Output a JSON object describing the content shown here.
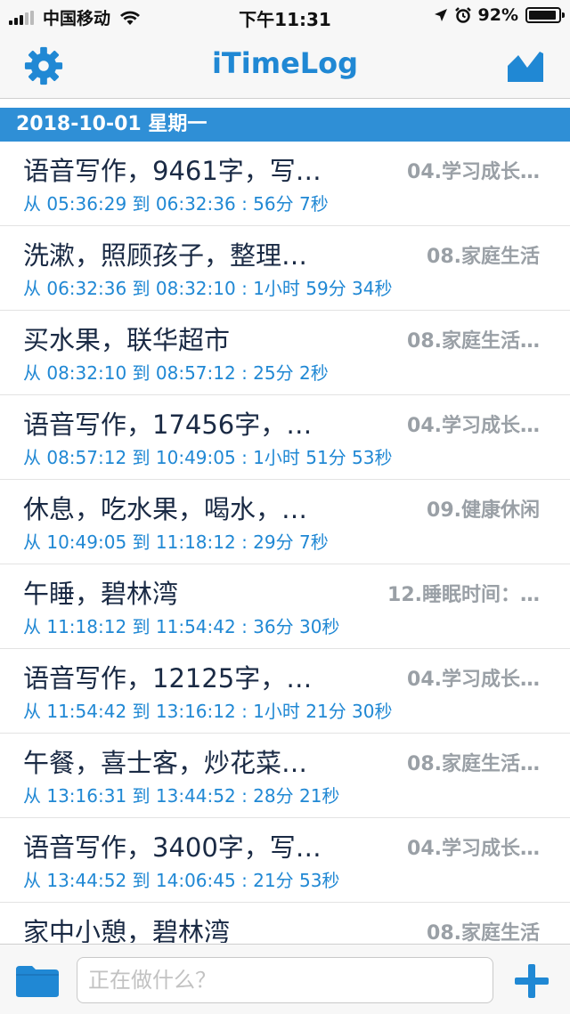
{
  "status_bar": {
    "carrier": "中国移动",
    "time": "下午11:31",
    "battery": "92%"
  },
  "nav": {
    "title": "iTimeLog"
  },
  "date_header": "2018-10-01 星期一",
  "entries": [
    {
      "title": "语音写作，9461字，写…",
      "category": "04.学习成长…",
      "time": "从 05:36:29  到 06:32:36 :  56分 7秒"
    },
    {
      "title": "洗漱，照顾孩子，整理…",
      "category": "08.家庭生活",
      "time": "从 06:32:36  到 08:32:10 : 1小时 59分 34秒"
    },
    {
      "title": "买水果，联华超市",
      "category": "08.家庭生活…",
      "time": "从 08:32:10  到 08:57:12 :  25分 2秒"
    },
    {
      "title": "语音写作，17456字，…",
      "category": "04.学习成长…",
      "time": "从 08:57:12  到 10:49:05 : 1小时 51分 53秒"
    },
    {
      "title": "休息，吃水果，喝水，…",
      "category": "09.健康休闲",
      "time": "从 10:49:05  到 11:18:12 :  29分 7秒"
    },
    {
      "title": "午睡，碧林湾",
      "category": "12.睡眠时间：…",
      "time": "从 11:18:12  到 11:54:42 :  36分 30秒"
    },
    {
      "title": "语音写作，12125字，…",
      "category": "04.学习成长…",
      "time": "从 11:54:42  到 13:16:12 : 1小时 21分 30秒"
    },
    {
      "title": "午餐，喜士客，炒花菜…",
      "category": "08.家庭生活…",
      "time": "从 13:16:31  到 13:44:52 :  28分 21秒"
    },
    {
      "title": "语音写作，3400字，写…",
      "category": "04.学习成长…",
      "time": "从 13:44:52  到 14:06:45 :  21分 53秒"
    },
    {
      "title": "家中小憩，碧林湾",
      "category": "08.家庭生活",
      "time": ""
    }
  ],
  "toolbar": {
    "input_placeholder": "正在做什么？"
  },
  "colors": {
    "accent": "#2088d4",
    "date_header_bg": "#2f8fd6",
    "category_gray": "#9aa0a6"
  }
}
